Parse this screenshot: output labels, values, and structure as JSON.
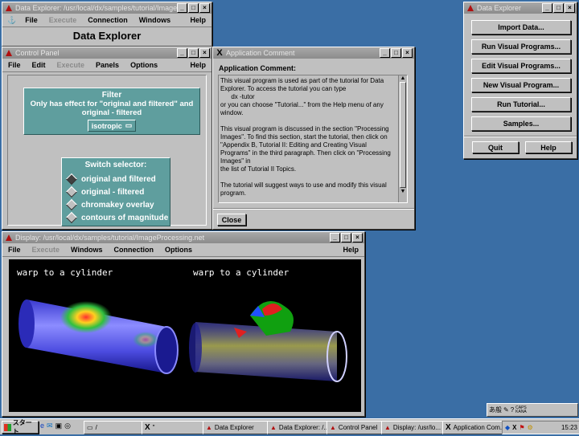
{
  "de_main": {
    "title": "Data Explorer: /usr/local/dx/samples/tutorial/ImageProcessing",
    "menu": [
      "File",
      "Execute",
      "Connection",
      "Windows",
      "Help"
    ],
    "heading": "Data Explorer"
  },
  "control_panel": {
    "title": "Control Panel",
    "menu": [
      "File",
      "Edit",
      "Execute",
      "Panels",
      "Options",
      "Help"
    ],
    "filter": {
      "title": "Filter",
      "subtitle": "Only has effect for \"original and filtered\" and original - filtered",
      "option_value": "isotropic"
    },
    "switch": {
      "title": "Switch selector:",
      "options": [
        "original and filtered",
        "original - filtered",
        "chromakey overlay",
        "contours of magnitude"
      ],
      "selected_index": 0
    }
  },
  "app_comment": {
    "title": "Application Comment",
    "label": "Application Comment:",
    "lines": [
      "This visual program is used as part of the tutorial for Data",
      "Explorer. To access the tutorial you can type",
      "      dx -tutor",
      "or you can choose \"Tutorial...\" from the Help menu of any",
      "window.",
      "",
      "This visual program is discussed in the section \"Processing",
      "Images\". To find this section, start the tutorial, then click on",
      "\"Appendix B, Tutorial II: Editing and Creating Visual",
      "Programs\" in the third paragraph. Then click on \"Processing",
      "Images\" in",
      "the list of Tutorial II Topics.",
      "",
      "The tutorial will suggest ways to use and modify this visual",
      "program."
    ],
    "close_label": "Close"
  },
  "de_launcher": {
    "title": "Data Explorer",
    "buttons": [
      "Import Data...",
      "Run Visual Programs...",
      "Edit Visual Programs...",
      "New Visual Program...",
      "Run Tutorial...",
      "Samples..."
    ],
    "quit_label": "Quit",
    "help_label": "Help"
  },
  "display": {
    "title": "Display: /usr/local/dx/samples/tutorial/ImageProcessing.net",
    "menu": [
      "File",
      "Execute",
      "Windows",
      "Connection",
      "Options",
      "Help"
    ],
    "caption_left": "warp to a cylinder",
    "caption_right": "warp to a cylinder"
  },
  "taskbar": {
    "start_label": "スタート",
    "tasks": [
      "Data Explorer",
      "Data Explorer: /...",
      "Control Panel",
      "Display: /usr/lo...",
      "Application Com..."
    ],
    "clock": "15:23",
    "ime_label": "あ般",
    "caps_label": "CAPS KANA"
  }
}
